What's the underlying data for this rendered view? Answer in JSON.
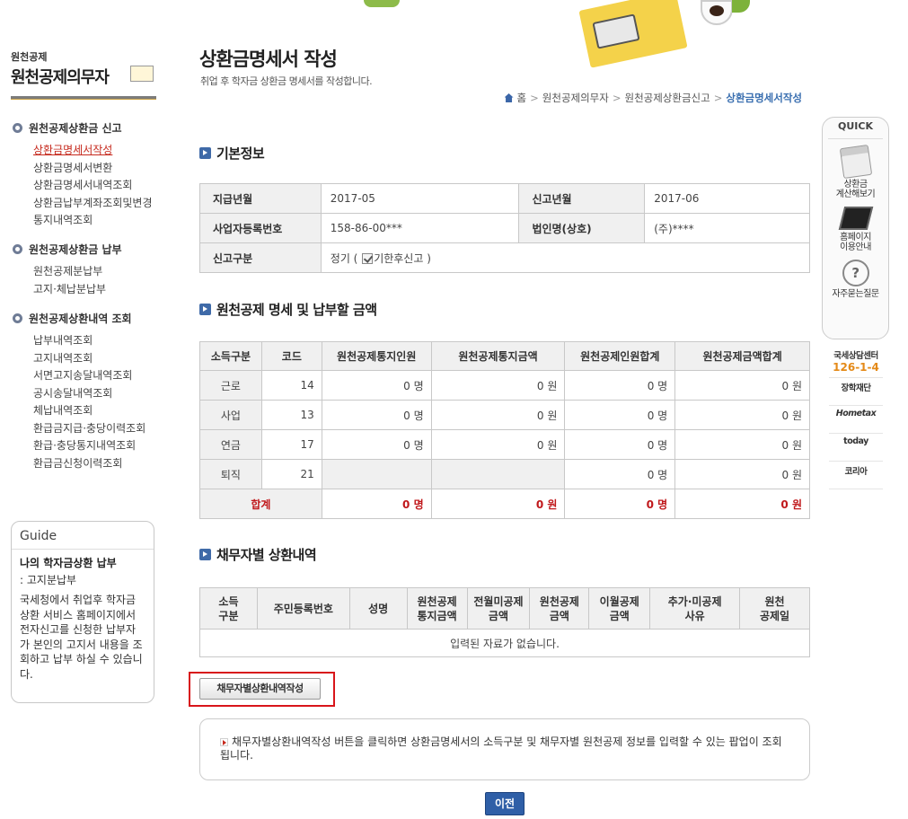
{
  "sidebar": {
    "brand_small": "원천공제",
    "brand_title": "원천공제의무자",
    "menus": [
      {
        "title": "원천공제상환금 신고",
        "items": [
          "상환금명세서작성",
          "상환금명세서변환",
          "상환금명세서내역조회",
          "상환금납부계좌조회및변경",
          "통지내역조회"
        ]
      },
      {
        "title": "원천공제상환금 납부",
        "items": [
          "원천공제분납부",
          "고지·체납분납부"
        ]
      },
      {
        "title": "원천공제상환내역 조회",
        "items": [
          "납부내역조회",
          "고지내역조회",
          "서면고지송달내역조회",
          "공시송달내역조회",
          "체납내역조회",
          "환급금지급·충당이력조회",
          "환급·충당통지내역조회",
          "환급금신청이력조회"
        ]
      }
    ]
  },
  "guide": {
    "title": "Guide",
    "subtitle": "나의 학자금상환 납부",
    "subtitle2": ": 고지분납부",
    "body": "국세청에서 취업후 학자금 상환 서비스 홈페이지에서 전자신고를 신청한 납부자가 본인의 고지서 내용을 조회하고 납부 하실 수 있습니다."
  },
  "page": {
    "title": "상환금명세서 작성",
    "subtitle": "취업 후 학자금 상환금 명세서를 작성합니다.",
    "breadcrumb": [
      "홈",
      "원천공제의무자",
      "원천공제상환금신고",
      "상환금명세서작성"
    ]
  },
  "basic": {
    "title": "기본정보",
    "pay_month_label": "지급년월",
    "pay_month": "2017-05",
    "report_month_label": "신고년월",
    "report_month": "2017-06",
    "bizno_label": "사업자등록번호",
    "bizno": "158-86-00***",
    "corp_label": "법인명(상호)",
    "corp": "(주)****",
    "report_type_label": "신고구분",
    "report_type_prefix": "정기 (",
    "report_type_check": "기한후신고",
    "report_type_suffix": ")"
  },
  "summary": {
    "title": "원천공제 명세 및 납부할 금액",
    "headers": [
      "소득구분",
      "코드",
      "원천공제통지인원",
      "원천공제통지금액",
      "원천공제인원합계",
      "원천공제금액합계"
    ],
    "rows": [
      {
        "type": "근로",
        "code": "14",
        "n_people": "0 명",
        "n_amount": "0 원",
        "s_people": "0 명",
        "s_amount": "0 원"
      },
      {
        "type": "사업",
        "code": "13",
        "n_people": "0 명",
        "n_amount": "0 원",
        "s_people": "0 명",
        "s_amount": "0 원"
      },
      {
        "type": "연금",
        "code": "17",
        "n_people": "0 명",
        "n_amount": "0 원",
        "s_people": "0 명",
        "s_amount": "0 원"
      },
      {
        "type": "퇴직",
        "code": "21",
        "s_people": "0 명",
        "s_amount": "0 원"
      }
    ],
    "total": {
      "label": "합계",
      "n_people": "0 명",
      "n_amount": "0 원",
      "s_people": "0 명",
      "s_amount": "0 원"
    }
  },
  "debt": {
    "title": "채무자별 상환내역",
    "headers": [
      "소득\n구분",
      "주민등록번호",
      "성명",
      "원천공제\n통지금액",
      "전월미공제\n금액",
      "원천공제\n금액",
      "이월공제\n금액",
      "추가·미공제\n사유",
      "원천\n공제일"
    ],
    "empty": "입력된 자료가 없습니다."
  },
  "write_button": "채무자별상환내역작성",
  "notice": "채무자별상환내역작성 버튼을 클릭하면 상환금명세서의 소득구분 및 채무자별 원천공제 정보를 입력할 수 있는 팝업이 조회됩니다.",
  "prev_button": "이전",
  "quick": {
    "title": "QUICK",
    "items": [
      "상환금\n계산해보기",
      "홈페이지\n이용안내",
      "자주묻는질문"
    ]
  },
  "banners": {
    "center_label": "국세상담센터",
    "center_phone": "126-1-4",
    "kosaf": "장학재단",
    "hometax": "Hometax",
    "today": "today",
    "korea": "코리아"
  },
  "colors": {
    "accent_blue": "#2f5fa7",
    "highlight_red": "#d8151a",
    "total_red": "#c0181b"
  }
}
